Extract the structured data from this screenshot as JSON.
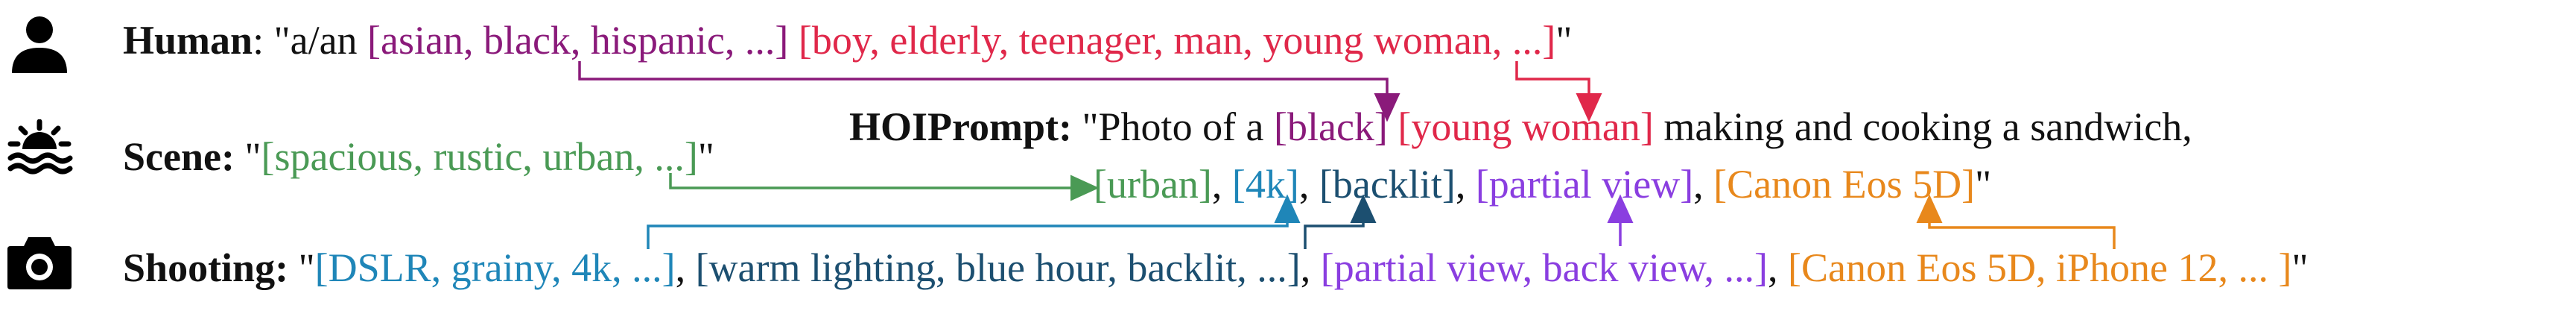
{
  "colors": {
    "ethnicity": "#8a1a7a",
    "person": "#e0284a",
    "scene": "#4a9a55",
    "quality": "#1f86b8",
    "lighting": "#1c4f70",
    "view": "#8a3ee0",
    "camera": "#e8881c",
    "text": "#111111"
  },
  "icons": [
    "person-icon",
    "scene-sunset-icon",
    "camera-icon"
  ],
  "human": {
    "label": "Human",
    "sep": ": \"a/an ",
    "ethnicity_list": "[asian, black, hispanic, ...]",
    "space": " ",
    "person_list": "[boy, elderly, teenager, man, young woman, ...]",
    "close": "\""
  },
  "scene": {
    "label": "Scene:",
    "open": " \"",
    "list": "[spacious, rustic, urban, ...]",
    "close": "\""
  },
  "shooting": {
    "label": "Shooting:",
    "open": " \"",
    "quality_list": "[DSLR, grainy, 4k, ...]",
    "sep1": ", ",
    "lighting_list": "[warm lighting, blue hour, backlit, ...]",
    "sep2": ", ",
    "view_list": "[partial view, back view, ...]",
    "sep3": ", ",
    "camera_list": "[Canon Eos 5D, iPhone 12, ... ]",
    "close": "\""
  },
  "hoiprompt": {
    "label": "HOIPrompt:",
    "pre": " \"Photo of a ",
    "ethnicity": "[black]",
    "space": " ",
    "person": "[young woman]",
    "post": " making and cooking a sandwich,",
    "scene": "[urban]",
    "c1": ", ",
    "quality": "[4k]",
    "c2": ", ",
    "lighting": "[backlit]",
    "c3": ", ",
    "view": "[partial view]",
    "c4": ", ",
    "camera": "[Canon Eos 5D]",
    "close": "\""
  }
}
